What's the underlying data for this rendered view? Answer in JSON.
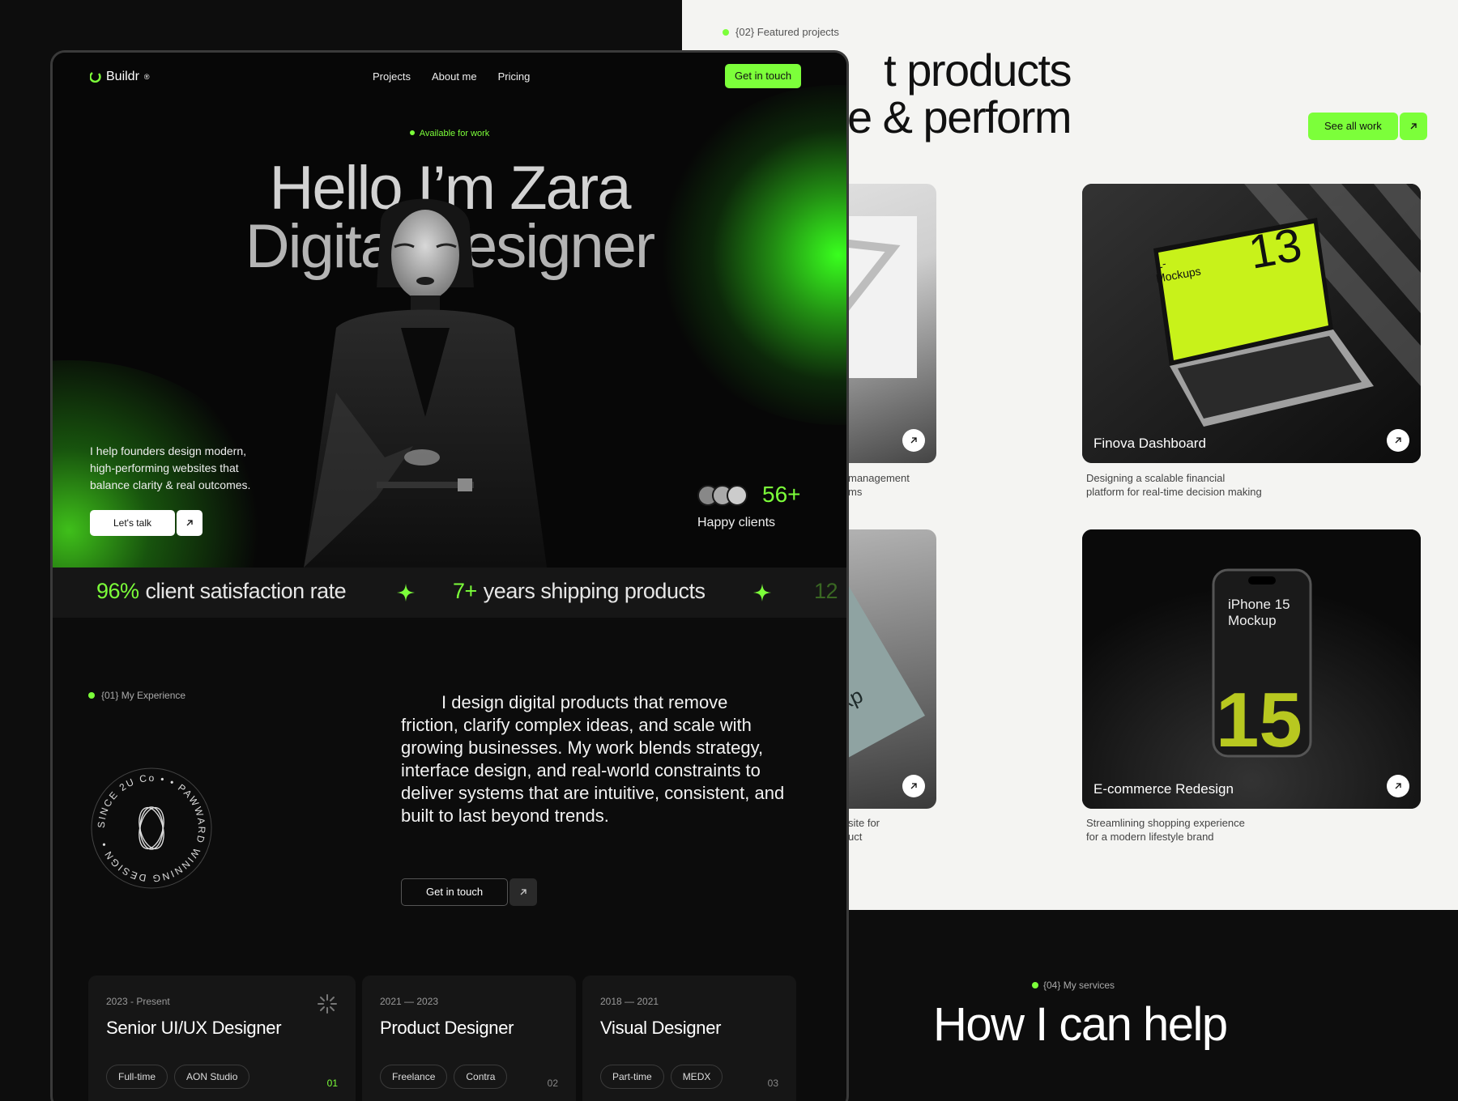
{
  "back_panel": {
    "eyebrow": "{02} Featured projects",
    "heading_line1": "t products",
    "heading_line2": "ale & perform",
    "see_all_label": "See all work",
    "projects": [
      {
        "title": "",
        "caption": "management\nms",
        "cut": true
      },
      {
        "title": "Finova Dashboard",
        "caption": "Designing a scalable financial\nplatform for real-time decision making",
        "mockup_label": "L-\nMockups",
        "mockup_number": "13"
      },
      {
        "title": "",
        "caption": "site for\nuct",
        "cut": true,
        "mockup_label": "[mag]mckp"
      },
      {
        "title": "E-commerce Redesign",
        "caption": "Streamlining shopping experience\nfor a modern lifestyle brand",
        "mockup_label": "iPhone 15\nMockup",
        "mockup_number": "15"
      }
    ],
    "services_eyebrow": "{04} My services",
    "services_title": "How I can help"
  },
  "nav": {
    "logo": "Buildr",
    "logo_mark": "®",
    "links": [
      "Projects",
      "About me",
      "Pricing"
    ],
    "cta": "Get in touch"
  },
  "hero": {
    "availability": "Available for work",
    "title_line1": "Hello I’m Zara",
    "title_line2": "Digital Designer",
    "description": "I help founders design modern, high-performing websites that balance clarity & real outcomes.",
    "cta_label": "Let's talk",
    "clients_count": "56+",
    "clients_label": "Happy clients"
  },
  "marquee": [
    {
      "value": "96%",
      "text": "client satisfaction rate"
    },
    {
      "value": "7+",
      "text": "years shipping products"
    },
    {
      "value": "12",
      "text": ""
    }
  ],
  "experience": {
    "eyebrow": "{01} My Experience",
    "badge_text": "SINCE 2U Co • • PAWWARD WINNING DESIGN •",
    "body": "I design digital products that remove friction, clarify complex ideas, and scale with growing businesses. My work blends strategy, interface design, and real-world constraints to deliver systems that are intuitive, consistent, and built to last beyond trends.",
    "cta_label": "Get in touch",
    "jobs": [
      {
        "period": "2023 - Present",
        "role": "Senior UI/UX Designer",
        "tags": [
          "Full-time",
          "AON Studio"
        ],
        "index": "01",
        "active": true
      },
      {
        "period": "2021 — 2023",
        "role": "Product Designer",
        "tags": [
          "Freelance",
          "Contra"
        ],
        "index": "02",
        "active": false
      },
      {
        "period": "2018 — 2021",
        "role": "Visual Designer",
        "tags": [
          "Part-time",
          "MEDX"
        ],
        "index": "03",
        "active": false
      }
    ]
  },
  "colors": {
    "accent": "#7cff3a",
    "bg_dark": "#0c0c0c",
    "bg_light": "#f4f4f2"
  }
}
